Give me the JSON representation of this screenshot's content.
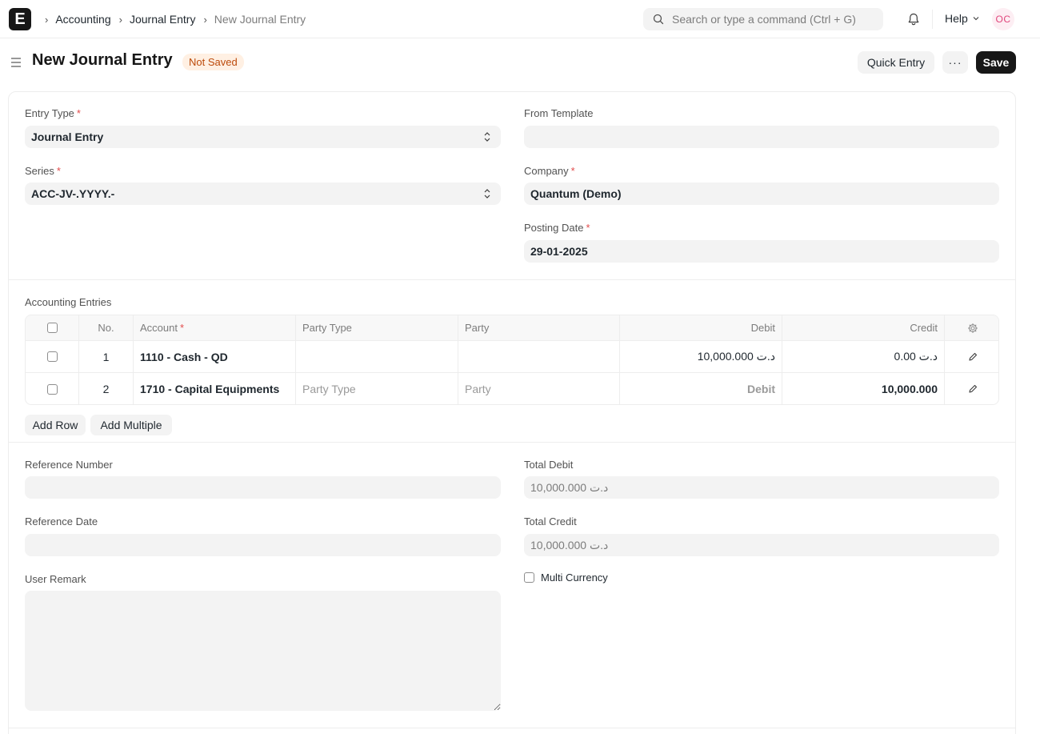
{
  "nav": {
    "logo_letter": "E",
    "breadcrumbs": [
      "Accounting",
      "Journal Entry",
      "New Journal Entry"
    ],
    "search_placeholder": "Search or type a command (Ctrl + G)",
    "help_label": "Help",
    "avatar_initials": "OC"
  },
  "page": {
    "title": "New Journal Entry",
    "status": "Not Saved",
    "quick_entry_label": "Quick Entry",
    "more_label": "···",
    "save_label": "Save"
  },
  "form": {
    "entry_type": {
      "label": "Entry Type",
      "value": "Journal Entry"
    },
    "from_template": {
      "label": "From Template",
      "value": ""
    },
    "series": {
      "label": "Series",
      "value": "ACC-JV-.YYYY.-"
    },
    "company": {
      "label": "Company",
      "value": "Quantum (Demo)"
    },
    "posting_date": {
      "label": "Posting Date",
      "value": "29-01-2025"
    },
    "required_mark": "*"
  },
  "accounts": {
    "section_label": "Accounting Entries",
    "columns": {
      "no": "No.",
      "account": "Account",
      "party_type": "Party Type",
      "party": "Party",
      "debit": "Debit",
      "credit": "Credit"
    },
    "rows": [
      {
        "no": "1",
        "account": "1110 - Cash - QD",
        "party_type": "",
        "party": "",
        "debit": "د.ت 10,000.000",
        "credit": "د.ت 0.00"
      },
      {
        "no": "2",
        "account": "1710 - Capital Equipments",
        "party_type": "Party Type",
        "party": "Party",
        "debit": "Debit",
        "credit": "10,000.000"
      }
    ],
    "add_row_label": "Add Row",
    "add_multiple_label": "Add Multiple"
  },
  "reference": {
    "reference_number": {
      "label": "Reference Number",
      "value": ""
    },
    "reference_date": {
      "label": "Reference Date",
      "value": ""
    },
    "user_remark": {
      "label": "User Remark",
      "value": ""
    },
    "total_debit": {
      "label": "Total Debit",
      "value": "د.ت 10,000.000"
    },
    "total_credit": {
      "label": "Total Credit",
      "value": "د.ت 10,000.000"
    },
    "multi_currency": {
      "label": "Multi Currency",
      "checked": false
    }
  }
}
